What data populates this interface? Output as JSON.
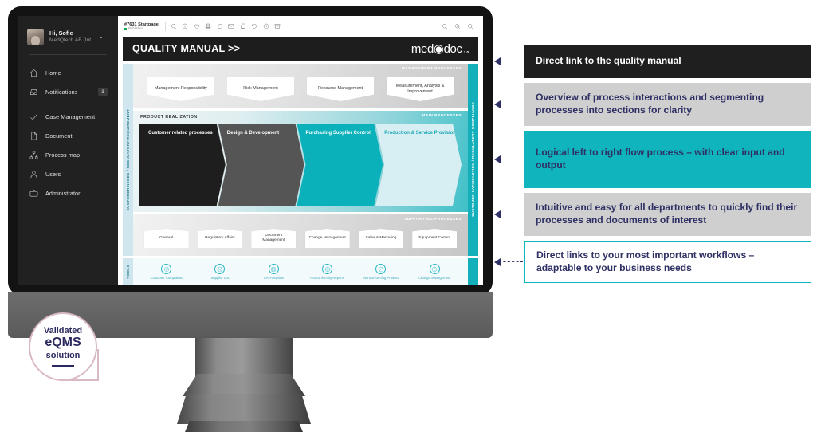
{
  "app": {
    "sidebar": {
      "profile": {
        "greeting": "Hi, Sofie",
        "org": "MedQtech AB (Inte...",
        "caret": "⌄"
      },
      "items": [
        {
          "label": "Home",
          "icon": "home-icon",
          "badge": ""
        },
        {
          "label": "Notifications",
          "icon": "inbox-icon",
          "badge": "3"
        },
        {
          "label": "Case Management",
          "icon": "check-icon",
          "badge": ""
        },
        {
          "label": "Document",
          "icon": "document-icon",
          "badge": ""
        },
        {
          "label": "Process map",
          "icon": "sitemap-icon",
          "badge": ""
        },
        {
          "label": "Users",
          "icon": "user-icon",
          "badge": ""
        },
        {
          "label": "Administrator",
          "icon": "briefcase-icon",
          "badge": ""
        }
      ]
    },
    "topbar": {
      "doc_id": "#7631 Startpage",
      "status": "Published",
      "icons_left": [
        "search-icon",
        "info-icon",
        "heart-icon",
        "print-icon",
        "comment-icon",
        "mail-icon",
        "copy-icon",
        "history-icon",
        "clock-icon",
        "archive-icon"
      ],
      "icons_right": [
        "zoom-out-icon",
        "zoom-in-icon",
        "search-icon"
      ]
    },
    "banner": {
      "title": "QUALITY MANUAL >>",
      "logo_pre": "med",
      "logo_post": "doc",
      "logo_version": "3.0"
    },
    "diagram": {
      "left_axis_label": "CUSTOMER NEEDS / REGULATORY REQUIREMENT",
      "left_tools_label": "TOOLS",
      "right_axis_label": "CUSTOMER SATISFACTION / REGULATORY COMPLIANCE",
      "management": {
        "band_label": "MANAGEMENT PROCESSES",
        "boxes": [
          "Management Responsibility",
          "Risk Management",
          "Resource Management",
          "Measurement, Analysis & Improvement"
        ]
      },
      "main": {
        "band_label": "MAIN PROCESSES",
        "section_label": "PRODUCT REALIZATION",
        "arrows": [
          {
            "label": "Customer related processes"
          },
          {
            "label": "Design & Development"
          },
          {
            "label": "Purchasing Supplier Control"
          },
          {
            "label": "Production & Service Provision"
          }
        ]
      },
      "supporting": {
        "band_label": "SUPPORTING PROCESSES",
        "boxes": [
          "General",
          "Regulatory Affairs",
          "Document Management",
          "Change Management",
          "Sales & Marketing",
          "Equipment Control"
        ]
      },
      "tools": [
        {
          "label": "Customer Complaints",
          "icon": "target-icon"
        },
        {
          "label": "Supplier List",
          "icon": "network-icon"
        },
        {
          "label": "CAPA reports",
          "icon": "lifebuoy-icon"
        },
        {
          "label": "Nonconformity Reports",
          "icon": "gear-icon"
        },
        {
          "label": "Nonconforming Product",
          "icon": "prohibited-icon"
        },
        {
          "label": "Change Management",
          "icon": "cycle-icon"
        }
      ]
    }
  },
  "badge": {
    "line1": "Validated",
    "line2": "eQMS",
    "line3": "solution"
  },
  "callouts": [
    {
      "text": "Direct link to the quality manual",
      "style": "c-dark"
    },
    {
      "text": "Overview of process interactions and segmenting processes into sections for clarity",
      "style": "c-gray"
    },
    {
      "text": "Logical left to right flow process – with clear input and output",
      "style": "c-teal"
    },
    {
      "text": "Intuitive and easy for all departments to quickly find their processes and documents of interest",
      "style": "c-gray"
    },
    {
      "text": "Direct links to your most important workflows – adaptable to your business needs",
      "style": "c-white"
    }
  ],
  "colors": {
    "teal": "#10b4bd",
    "navy": "#2f3064",
    "dark": "#1f1f1f",
    "gray": "#cfcfcf"
  }
}
